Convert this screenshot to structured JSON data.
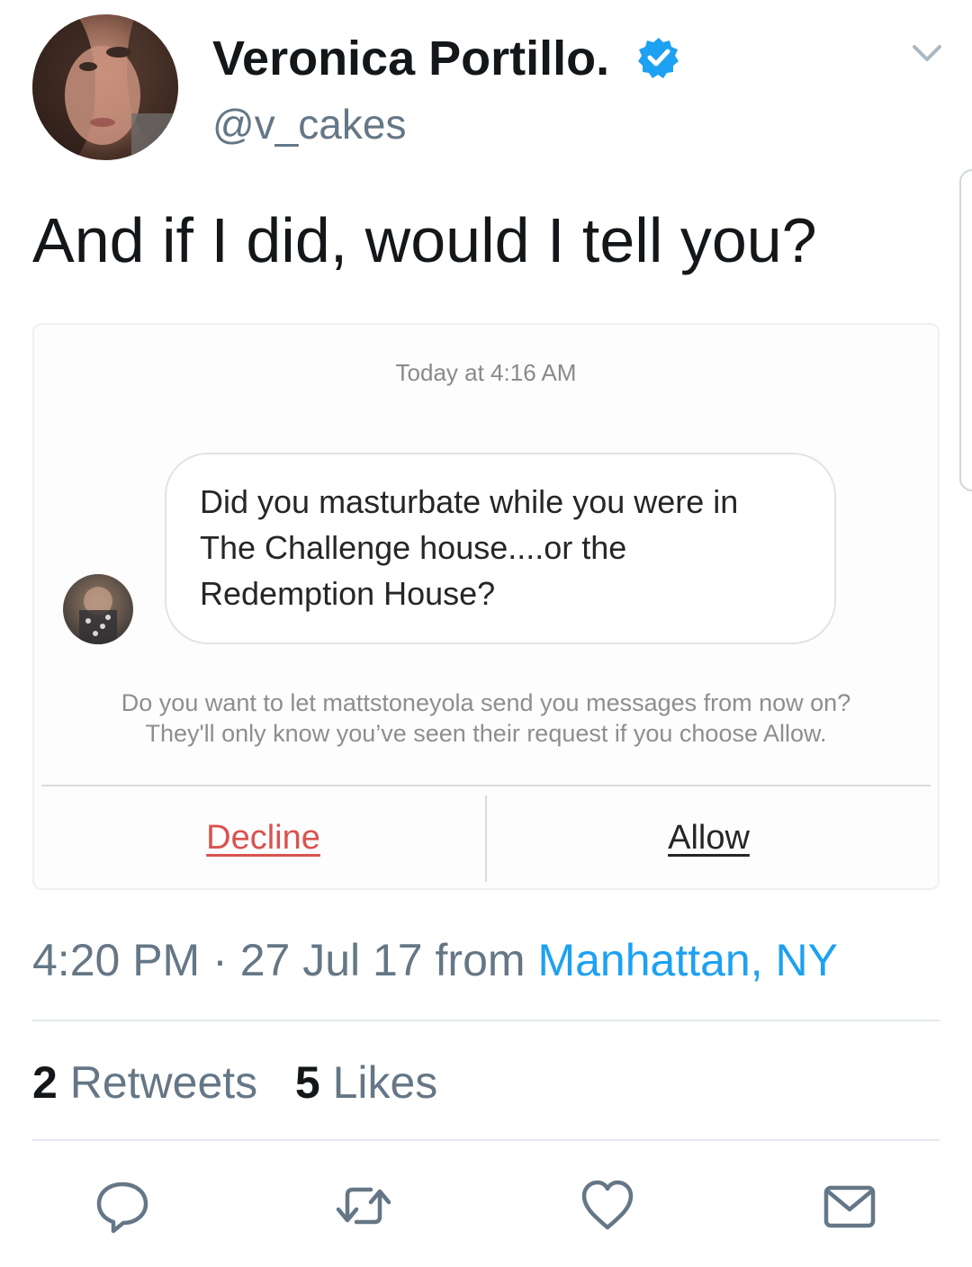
{
  "author": {
    "display_name": "Veronica Portillo.",
    "handle": "@v_cakes"
  },
  "tweet": {
    "text": "And if I did, would I tell you?"
  },
  "dm_screenshot": {
    "timestamp": "Today at 4:16 AM",
    "message_lines": [
      "Did you masturbate while you were in",
      "The Challenge house....or the",
      "Redemption House?"
    ],
    "request_note_lines": [
      "Do you want to let mattstoneyola send you messages from now on?",
      "They'll only know you’ve seen their request if you choose Allow."
    ],
    "decline_label": "Decline",
    "allow_label": "Allow"
  },
  "meta": {
    "time": "4:20 PM",
    "separator": "·",
    "date": "27 Jul 17",
    "from_word": "from",
    "location": "Manhattan, NY"
  },
  "stats": {
    "retweets_count": "2",
    "retweets_label": "Retweets",
    "likes_count": "5",
    "likes_label": "Likes"
  },
  "colors": {
    "verified": "#1da1f2",
    "link": "#1da1f2",
    "muted": "#657786",
    "decline": "#d9534f"
  },
  "icons": [
    "verified-badge-icon",
    "chevron-down-icon",
    "reply-icon",
    "retweet-icon",
    "like-icon",
    "direct-message-icon"
  ]
}
